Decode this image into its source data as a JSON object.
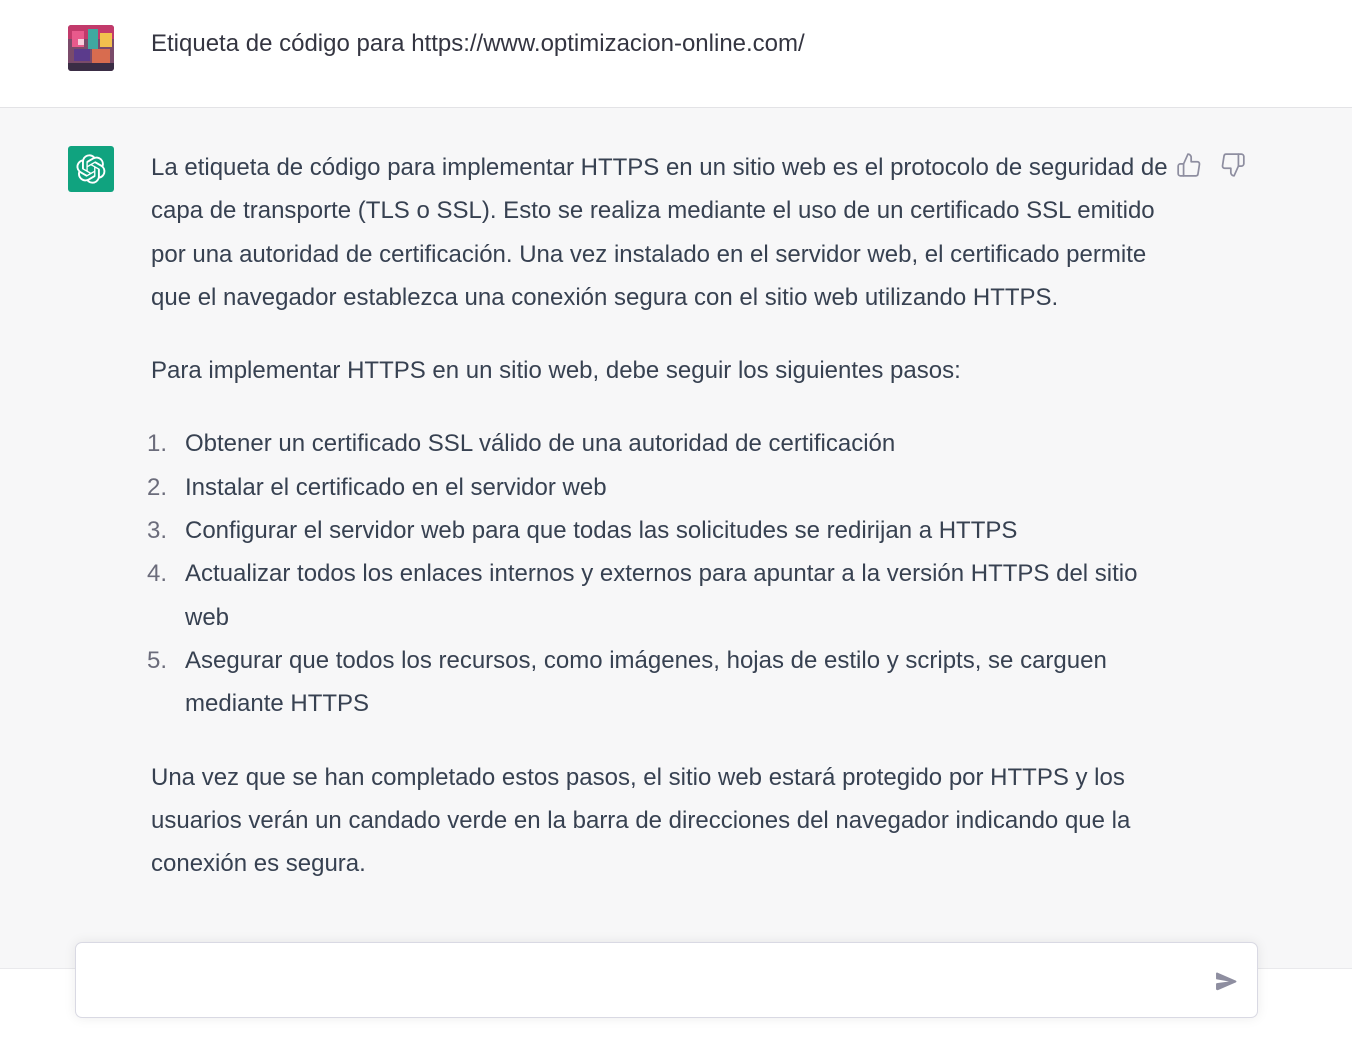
{
  "user_message": {
    "text": "Etiqueta de código para https://www.optimizacion-online.com/"
  },
  "assistant_message": {
    "paragraph_1": "La etiqueta de código para implementar HTTPS en un sitio web es el protocolo de seguridad de capa de transporte (TLS o SSL). Esto se realiza mediante el uso de un certificado SSL emitido por una autoridad de certificación. Una vez instalado en el servidor web, el certificado permite que el navegador establezca una conexión segura con el sitio web utilizando HTTPS.",
    "paragraph_2": "Para implementar HTTPS en un sitio web, debe seguir los siguientes pasos:",
    "steps": [
      {
        "num": "1.",
        "text": "Obtener un certificado SSL válido de una autoridad de certificación"
      },
      {
        "num": "2.",
        "text": "Instalar el certificado en el servidor web"
      },
      {
        "num": "3.",
        "text": "Configurar el servidor web para que todas las solicitudes se redirijan a HTTPS"
      },
      {
        "num": "4.",
        "text": "Actualizar todos los enlaces internos y externos para apuntar a la versión HTTPS del sitio web"
      },
      {
        "num": "5.",
        "text": "Asegurar que todos los recursos, como imágenes, hojas de estilo y scripts, se carguen mediante HTTPS"
      }
    ],
    "paragraph_3": "Una vez que se han completado estos pasos, el sitio web estará protegido por HTTPS y los usuarios verán un candado verde en la barra de direcciones del navegador indicando que la conexión es segura."
  },
  "composer": {
    "value": "",
    "placeholder": ""
  },
  "icons": {
    "assistant_avatar": "openai-logo-icon",
    "thumbs_up": "thumbs-up-icon",
    "thumbs_down": "thumbs-down-icon",
    "send": "send-icon"
  },
  "colors": {
    "assistant_avatar_bg": "#10a37f",
    "assistant_row_bg": "#f7f7f8",
    "user_row_bg": "#ffffff",
    "text": "#374151"
  }
}
